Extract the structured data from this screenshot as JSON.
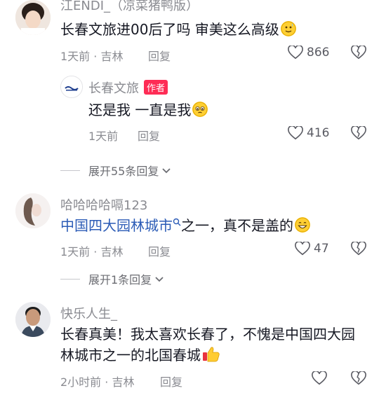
{
  "comments": [
    {
      "username": "江ENDI_（凉菜猪鸭版）",
      "text": "长春文旅进00后了吗 审美这么高级",
      "time": "1天前",
      "location": "吉林",
      "reply_label": "回复",
      "likes": "866",
      "reply": {
        "username": "长春文旅",
        "author_badge": "作者",
        "text": "还是我 一直是我",
        "time": "1天前",
        "reply_label": "回复",
        "likes": "416"
      },
      "expand_label": "展开55条回复"
    },
    {
      "username": "哈哈哈哈嗝123",
      "text_link": "中国四大园林城市",
      "text_rest": "之一，真不是盖的",
      "time": "1天前",
      "location": "吉林",
      "reply_label": "回复",
      "likes": "47",
      "expand_label": "展开1条回复"
    },
    {
      "username": "快乐人生_",
      "text_line1": "长春真美！我太喜欢长春了，不愧是中国四大园",
      "text_line2": "林城市之一的北国春城",
      "time": "2小时前",
      "location": "吉林",
      "reply_label": "回复"
    }
  ],
  "separator": "·",
  "colors": {
    "accent_link": "#2b5bb6",
    "author_badge": "#fe2c55",
    "muted": "#8a8b91"
  }
}
